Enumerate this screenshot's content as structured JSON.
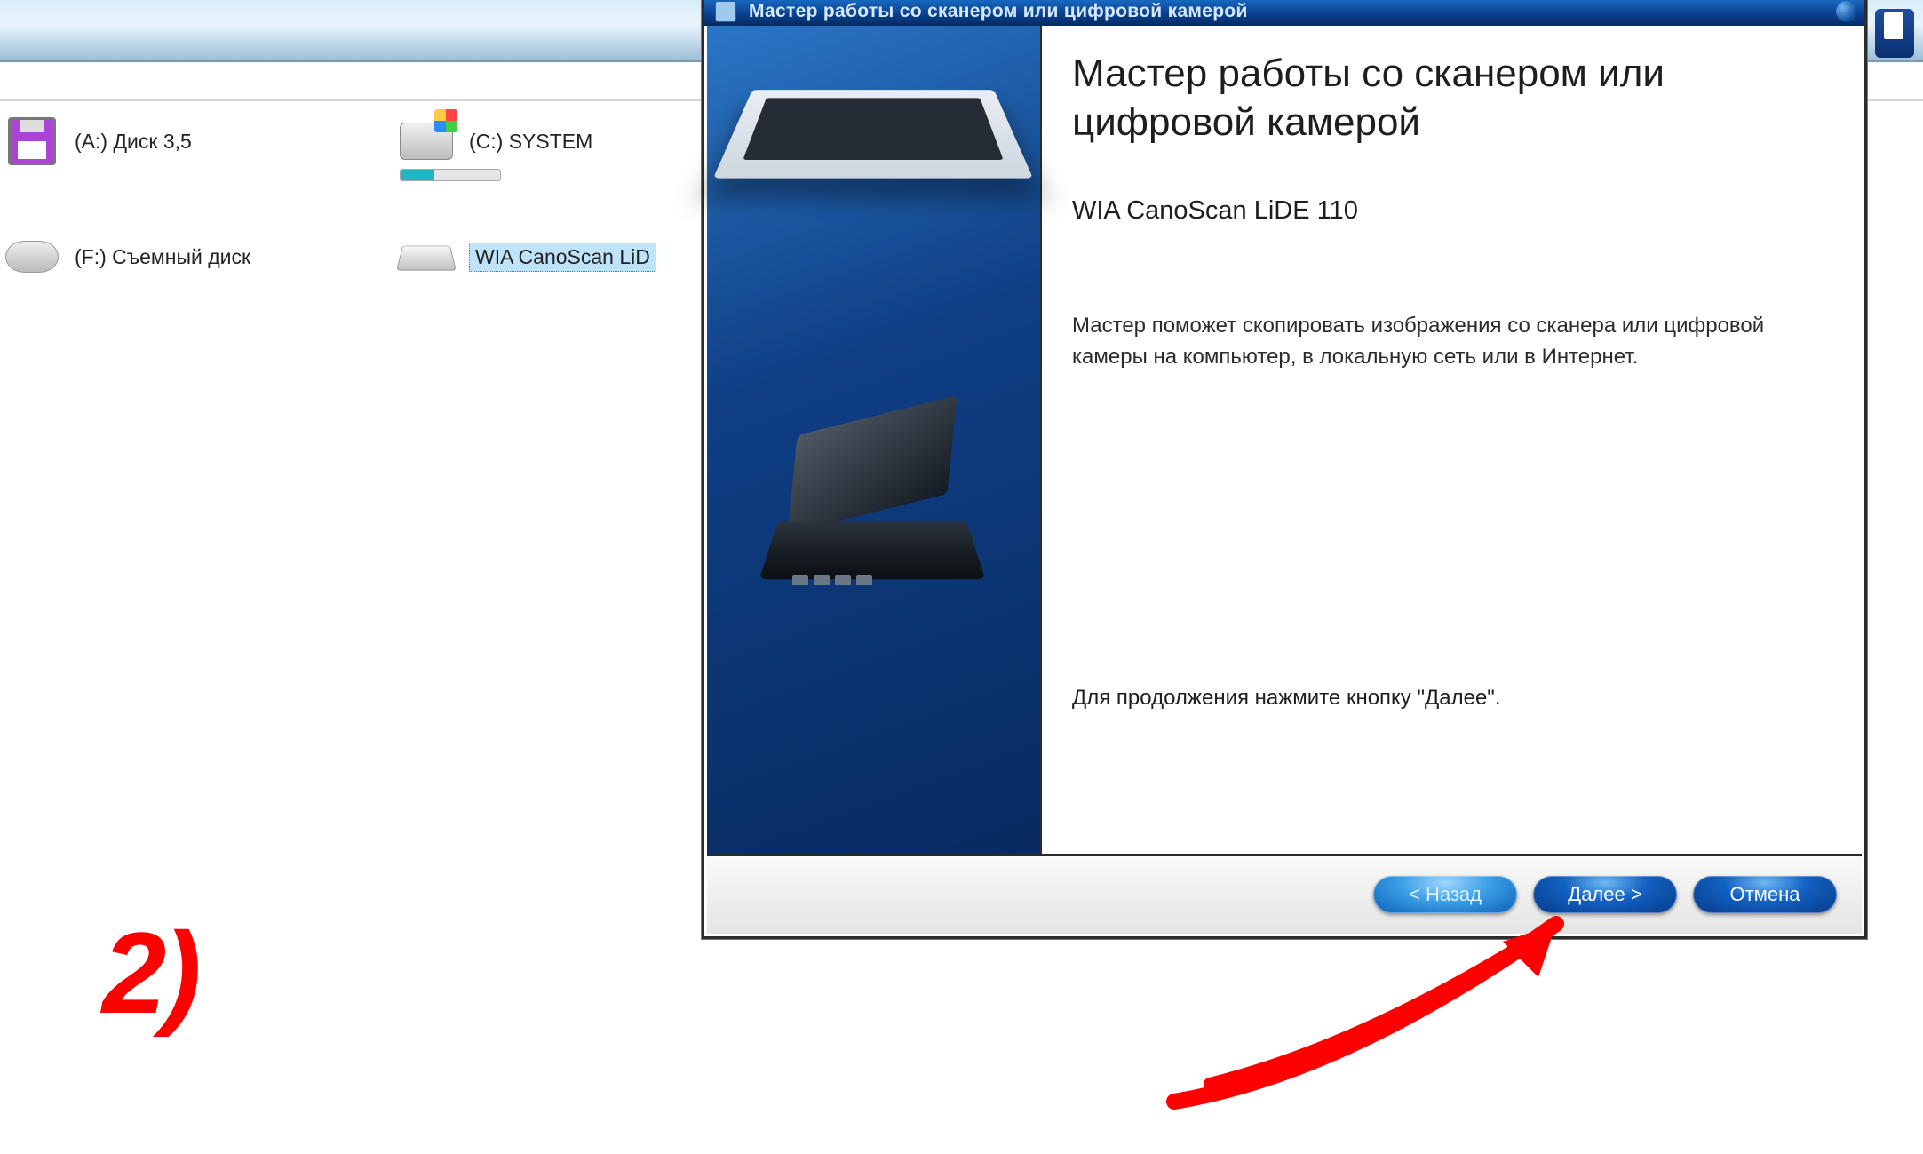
{
  "explorer": {
    "drives": [
      {
        "label": "(A:) Диск 3,5"
      },
      {
        "label": "(C:) SYSTEM"
      },
      {
        "label": "(F:) Съемный диск"
      },
      {
        "label": "WIA CanoScan LiD"
      }
    ]
  },
  "wizard": {
    "window_title": "Мастер работы со сканером или цифровой камерой",
    "heading": "Мастер работы со сканером или цифровой камерой",
    "device_name": "WIA CanoScan LiDE 110",
    "description": "Мастер поможет скопировать изображения со сканера или цифровой камеры на компьютер, в локальную сеть или в Интернет.",
    "continue_hint": "Для продолжения нажмите кнопку \"Далее\".",
    "buttons": {
      "back": "< Назад",
      "next": "Далее >",
      "cancel": "Отмена"
    }
  },
  "annotation": {
    "step_label": "2)"
  }
}
